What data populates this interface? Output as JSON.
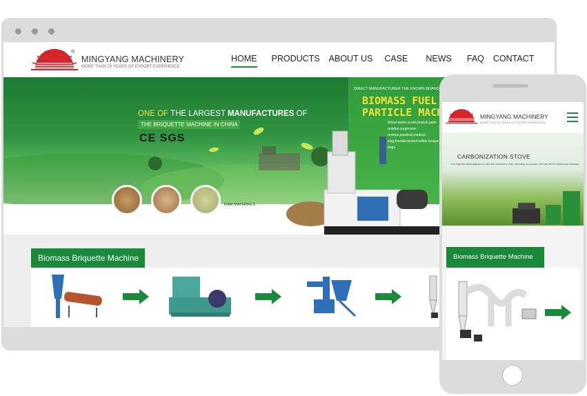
{
  "brand": {
    "name": "MINGYANG MACHINERY",
    "tagline": "MORE THAN 20 YEARS OF EXPORT EXPERIENCE",
    "registered": "®",
    "colors": {
      "green": "#1a8a3a",
      "red": "#d4262a",
      "yellow": "#f2e23a"
    }
  },
  "desktop": {
    "nav": [
      {
        "label": "HOME",
        "active": true
      },
      {
        "label": "PRODUCTS",
        "active": false
      },
      {
        "label": "ABOUT US",
        "active": false
      },
      {
        "label": "CASE",
        "active": false
      },
      {
        "label": "NEWS",
        "active": false
      },
      {
        "label": "FAQ",
        "active": false
      },
      {
        "label": "CONTACT",
        "active": false
      }
    ],
    "hero": {
      "line1_a": "ONE OF",
      "line1_b": "THE LARGEST",
      "line1_c": "MANUFACTURES",
      "line1_d": "OF",
      "line2": "THE BRIQUETTE MACHINE IN CHINA",
      "certs": "CE SGS",
      "raw_label": "RAW MATERIALS",
      "promo_top": "DIRECT MANUFACTURER THE KNOWN BRAND OF FLAT DIE",
      "promo_title1": "BIOMASS FUEL",
      "promo_title2": "PARTICLE MACHINE",
      "promo_text": "Wood waste,scobs,branch,palm residue,sugarcane residue,sawdust,medical slag,fossil&cracked edible fungus bags."
    },
    "section_title": "Biomass Briquette Machine"
  },
  "mobile": {
    "banner_title": "CARBONIZATION STOVE",
    "banner_sub": "It is how the advantageous to use the machinery cost, and easy to operate, and can be in continuous charcoal",
    "section_title": "Biomass Briquette Machine"
  },
  "icons": [
    "sun-logo-icon",
    "menu-icon",
    "arrow-right-icon"
  ]
}
